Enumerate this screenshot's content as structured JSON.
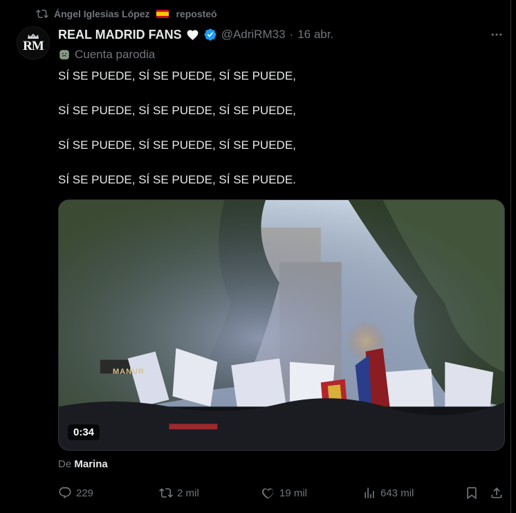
{
  "repost": {
    "user": "Ángel Iglesias López",
    "flag_icon": "spain-flag-icon",
    "action": "reposteó"
  },
  "author": {
    "name": "REAL MADRID FANS",
    "handle": "@AdriRM33",
    "separator": "·",
    "date": "16 abr.",
    "avatar_text": "RM",
    "label": "Cuenta parodia"
  },
  "text_lines": [
    "SÍ SE PUEDE, SÍ SE PUEDE, SÍ SE PUEDE,",
    "SÍ SE PUEDE, SÍ SE PUEDE, SÍ SE PUEDE,",
    "SÍ SE PUEDE, SÍ SE PUEDE, SÍ SE PUEDE,",
    "SÍ SE PUEDE, SÍ SE PUEDE, SÍ SE PUEDE."
  ],
  "media": {
    "duration": "0:34",
    "sign_text": "MANUR"
  },
  "credit": {
    "prefix": "De",
    "name": "Marina"
  },
  "actions": {
    "replies": "229",
    "reposts": "2 mil",
    "likes": "19 mil",
    "views": "643 mil"
  },
  "colors": {
    "background": "#000000",
    "text": "#e7e9ea",
    "muted": "#71767b",
    "verified": "#1d9bf0"
  }
}
